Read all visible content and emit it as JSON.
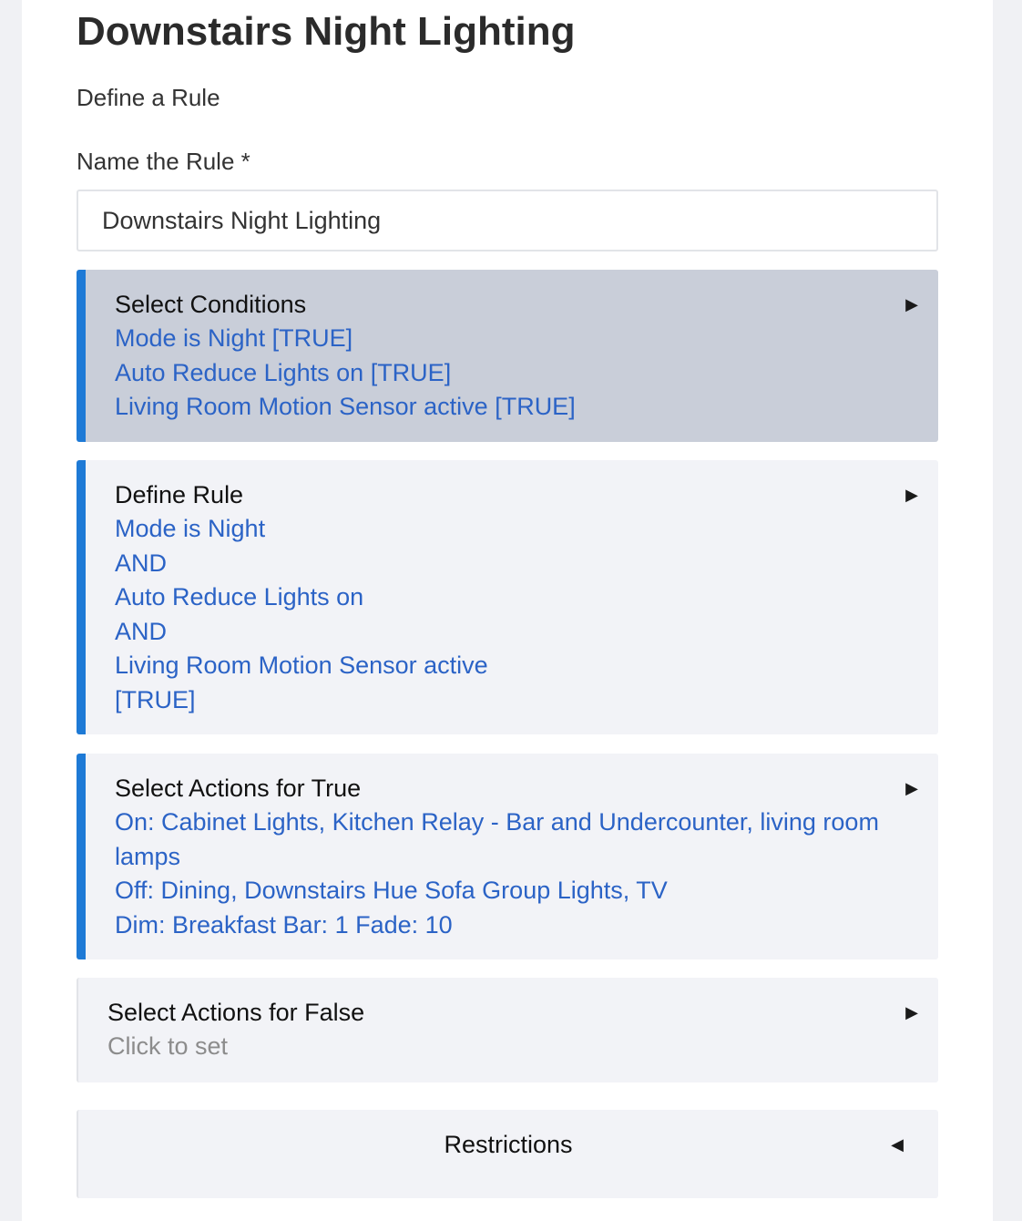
{
  "page": {
    "title": "Downstairs Night Lighting",
    "subtitle": "Define a Rule"
  },
  "name_field": {
    "label": "Name the Rule *",
    "value": "Downstairs Night Lighting"
  },
  "conditions": {
    "title": "Select Conditions",
    "lines": [
      "Mode is Night [TRUE]",
      "Auto Reduce Lights on [TRUE]",
      "Living Room Motion Sensor active [TRUE]"
    ]
  },
  "define_rule": {
    "title": "Define Rule",
    "lines": [
      "Mode is Night",
      "AND",
      "Auto Reduce Lights on",
      "AND",
      "Living Room Motion Sensor active",
      "[TRUE]"
    ]
  },
  "actions_true": {
    "title": "Select Actions for True",
    "lines": [
      "On: Cabinet Lights, Kitchen Relay - Bar and Undercounter, living room lamps",
      "Off: Dining, Downstairs Hue Sofa Group Lights, TV",
      "Dim: Breakfast Bar: 1 Fade: 10"
    ]
  },
  "actions_false": {
    "title": "Select Actions for False",
    "placeholder": "Click to set"
  },
  "restrictions": {
    "title": "Restrictions"
  },
  "icons": {
    "expand": "▶",
    "collapse": "◀"
  },
  "colors": {
    "accent": "#1e7ad6",
    "link": "#2b63c6",
    "selected_card": "#c9ced9",
    "card": "#f2f3f7"
  }
}
